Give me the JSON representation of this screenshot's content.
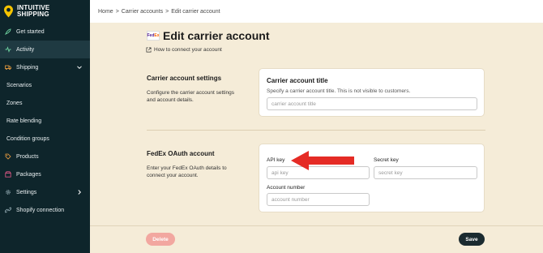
{
  "brand": {
    "line1": "INTUITIVE",
    "line2": "SHIPPING",
    "accent_color": "#f5c400"
  },
  "sidebar": {
    "items": [
      {
        "label": "Get started",
        "icon": "rocket-icon"
      },
      {
        "label": "Activity",
        "icon": "activity-icon",
        "active": true
      },
      {
        "label": "Shipping",
        "icon": "truck-icon",
        "expandable": "chevron-down-icon"
      },
      {
        "label": "Scenarios"
      },
      {
        "label": "Zones"
      },
      {
        "label": "Rate blending"
      },
      {
        "label": "Condition groups"
      },
      {
        "label": "Products",
        "icon": "tag-icon"
      },
      {
        "label": "Packages",
        "icon": "package-icon"
      },
      {
        "label": "Settings",
        "icon": "gear-icon",
        "expandable": "chevron-right-icon"
      },
      {
        "label": "Shopify connection",
        "icon": "link-icon"
      }
    ]
  },
  "breadcrumb": {
    "home": "Home",
    "carrier_accounts": "Carrier accounts",
    "current": "Edit carrier account",
    "separator": ">"
  },
  "page": {
    "title": "Edit carrier account",
    "logo_fe": "Fed",
    "logo_ex": "Ex",
    "help_link": "How to connect your account"
  },
  "settings_section": {
    "heading": "Carrier account settings",
    "description_line1": "Configure the carrier account settings",
    "description_line2": "and account details.",
    "card": {
      "title": "Carrier account title",
      "description": "Specify a carrier account title. This is not visible to customers.",
      "input_placeholder": "carrier account title",
      "input_value": ""
    }
  },
  "oauth_section": {
    "heading": "FedEx OAuth account",
    "description_line1": "Enter your FedEx OAuth details to",
    "description_line2": "connect your account.",
    "api_key": {
      "label": "API key",
      "placeholder": "api key",
      "value": ""
    },
    "secret_key": {
      "label": "Secret key",
      "placeholder": "secret key",
      "value": ""
    },
    "account_number": {
      "label": "Account number",
      "placeholder": "account number",
      "value": ""
    }
  },
  "actions": {
    "delete_label": "Delete",
    "save_label": "Save",
    "delete_color": "#f2a7a0",
    "save_color": "#1b2b30"
  },
  "annotation": {
    "arrow_color": "#e52b25"
  }
}
